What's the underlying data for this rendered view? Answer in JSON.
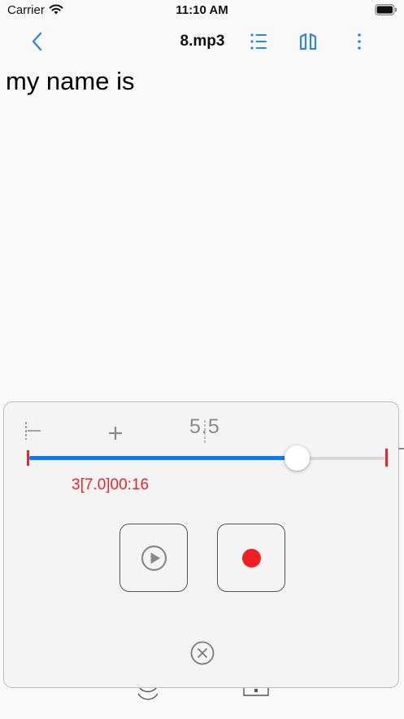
{
  "status_bar": {
    "carrier": "Carrier",
    "time": "11:10 AM",
    "icons": [
      "wifi-icon",
      "battery-icon"
    ]
  },
  "nav": {
    "title": "8.mp3",
    "icons": [
      "back-chevron-icon",
      "list-icon",
      "columns-icon",
      "more-vertical-icon"
    ],
    "accent_color": "#2f86e8"
  },
  "transcript": {
    "text": "my name is"
  },
  "recorder": {
    "speed": "5.5",
    "position_text": "3[7.0]00:16",
    "progress_fraction": 0.75,
    "icons": [
      "trim-start-icon",
      "plus-icon",
      "play-icon",
      "record-icon",
      "close-icon"
    ],
    "colors": {
      "track_fill": "#0a7cf2",
      "markers": "#e8252a",
      "record": "#ee2024"
    }
  }
}
